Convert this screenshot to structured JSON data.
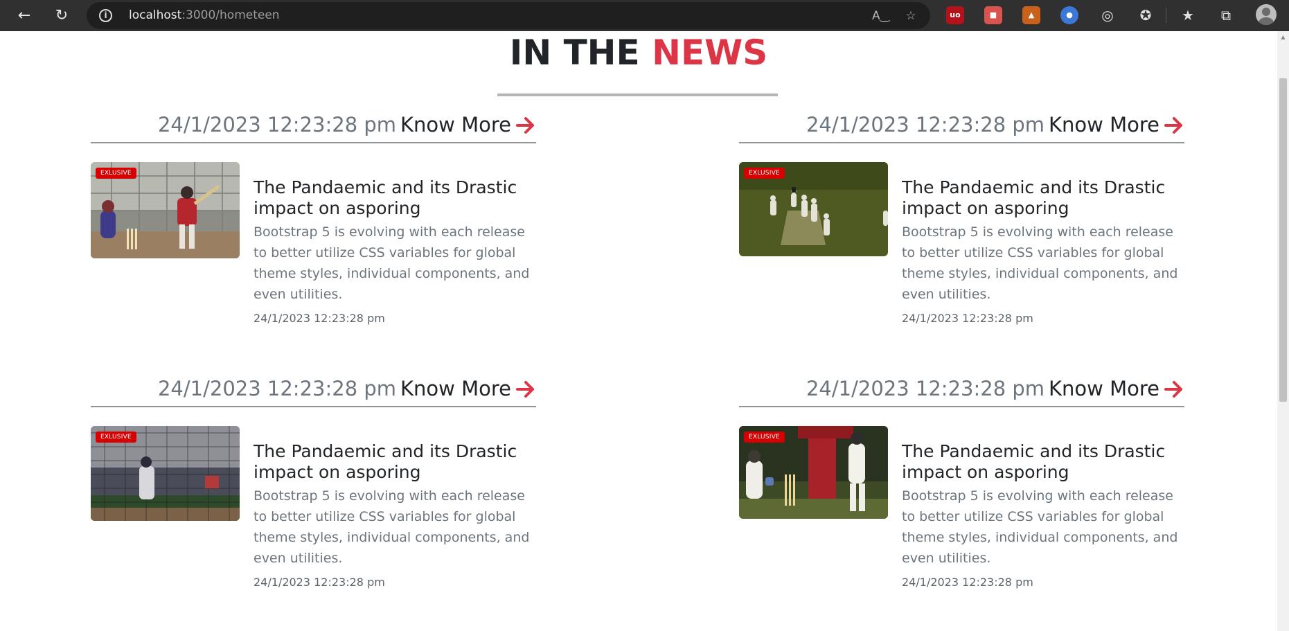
{
  "browser": {
    "url_host": "localhost",
    "url_path": ":3000/hometeen"
  },
  "section": {
    "title_prefix": "IN THE ",
    "title_accent": "NEWS"
  },
  "colors": {
    "accent": "#dc3545",
    "badge": "#d60000"
  },
  "cards": [
    {
      "date": "24/1/2023 12:23:28 pm",
      "know_more": "Know More",
      "badge": "EXLUSIVE",
      "headline": "The Pandaemic and its Drastic impact on asporing",
      "description": "Bootstrap 5 is evolving with each release to better utilize CSS variables for global theme styles, individual components, and even utilities.",
      "timestamp": "24/1/2023 12:23:28 pm",
      "image": "cricket-batsman-photo"
    },
    {
      "date": "24/1/2023 12:23:28 pm",
      "know_more": "Know More",
      "badge": "EXLUSIVE",
      "headline": "The Pandaemic and its Drastic impact on asporing",
      "description": "Bootstrap 5 is evolving with each release to better utilize CSS variables for global theme styles, individual components, and even utilities.",
      "timestamp": "24/1/2023 12:23:28 pm",
      "image": "cricket-field-photo"
    },
    {
      "date": "24/1/2023 12:23:28 pm",
      "know_more": "Know More",
      "badge": "EXLUSIVE",
      "headline": "The Pandaemic and its Drastic impact on asporing",
      "description": "Bootstrap 5 is evolving with each release to better utilize CSS variables for global theme styles, individual components, and even utilities.",
      "timestamp": "24/1/2023 12:23:28 pm",
      "image": "baseball-stadium-photo"
    },
    {
      "date": "24/1/2023 12:23:28 pm",
      "know_more": "Know More",
      "badge": "EXLUSIVE",
      "headline": "The Pandaemic and its Drastic impact on asporing",
      "description": "Bootstrap 5 is evolving with each release to better utilize CSS variables for global theme styles, individual components, and even utilities.",
      "timestamp": "24/1/2023 12:23:28 pm",
      "image": "cricket-wicketkeeper-photo"
    }
  ]
}
